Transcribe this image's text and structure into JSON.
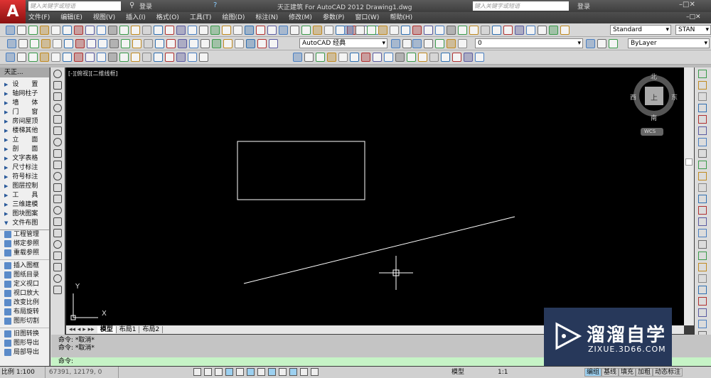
{
  "title": {
    "app_text": "天正建筑 For AutoCAD 2012    Drawing1.dwg",
    "search_placeholder": "键入关键字或短语",
    "login": "登录",
    "help": "?"
  },
  "menu": [
    "文件(F)",
    "编辑(E)",
    "视图(V)",
    "插入(I)",
    "格式(O)",
    "工具(T)",
    "绘图(D)",
    "标注(N)",
    "修改(M)",
    "参数(P)",
    "窗口(W)",
    "帮助(H)"
  ],
  "toolbar": {
    "style_combo": "Standard",
    "style_combo2": "STAN",
    "workspace": "AutoCAD 经典",
    "layer": "0",
    "linetype": "ByLayer"
  },
  "palette": {
    "title": "天正...",
    "sections": [
      "设　　置",
      "轴网柱子",
      "墙　　体",
      "门　　窗",
      "房间屋顶",
      "楼梯其他",
      "立　　面",
      "剖　　面",
      "文字表格",
      "尺寸标注",
      "符号标注",
      "图层控制",
      "工　　具",
      "三维建模",
      "图块图案"
    ],
    "expanded": "文件布图",
    "tools": [
      "工程管理",
      "绑定参照",
      "重载参照",
      "插入图框",
      "图纸目录",
      "定义视口",
      "视口放大",
      "改变比例",
      "布局旋转",
      "图形切割",
      "旧图转换",
      "图形导出",
      "局部导出"
    ]
  },
  "viewport": {
    "label": "[-][俯视][二维线框]",
    "compass": {
      "n": "北",
      "s": "南",
      "e": "东",
      "w": "西",
      "top": "上",
      "wcs": "WCS"
    },
    "ucs": {
      "x": "X",
      "y": "Y"
    }
  },
  "tabs": [
    "模型",
    "布局1",
    "布局2"
  ],
  "command": {
    "history": [
      "命令: *取消*",
      "命令: *取消*"
    ],
    "prompt": "命令:"
  },
  "status": {
    "scale": "比例 1:100",
    "coords": "67391, 12179, 0",
    "model": "模型",
    "annotation_scale": "1:1",
    "buttons": [
      "编组",
      "基线",
      "填充",
      "加粗",
      "动态标注"
    ]
  },
  "watermark": {
    "name": "溜溜自学",
    "url": "ZIXUE.3D66.COM"
  }
}
